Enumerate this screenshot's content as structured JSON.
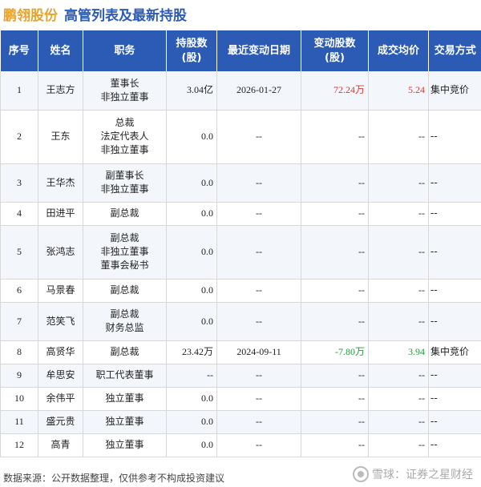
{
  "header": {
    "company": "鹏翎股份",
    "subtitle": "高管列表及最新持股"
  },
  "columns": [
    "序号",
    "姓名",
    "职务",
    "持股数\n(股)",
    "最近变动日期",
    "变动股数\n(股)",
    "成交均价",
    "交易方式"
  ],
  "rows": [
    {
      "no": "1",
      "name": "王志方",
      "roles": [
        "董事长",
        "非独立董事"
      ],
      "shares": "3.04亿",
      "date": "2026-01-27",
      "change": "72.24万",
      "change_color": "red",
      "price": "5.24",
      "price_color": "red",
      "method": "集中竞价"
    },
    {
      "no": "2",
      "name": "王东",
      "roles": [
        "总裁",
        "法定代表人",
        "非独立董事"
      ],
      "shares": "0.0",
      "date": "--",
      "change": "--",
      "change_color": "",
      "price": "--",
      "price_color": "",
      "method": "--"
    },
    {
      "no": "3",
      "name": "王华杰",
      "roles": [
        "副董事长",
        "非独立董事"
      ],
      "shares": "0.0",
      "date": "--",
      "change": "--",
      "change_color": "",
      "price": "--",
      "price_color": "",
      "method": "--"
    },
    {
      "no": "4",
      "name": "田进平",
      "roles": [
        "副总裁"
      ],
      "shares": "0.0",
      "date": "--",
      "change": "--",
      "change_color": "",
      "price": "--",
      "price_color": "",
      "method": "--"
    },
    {
      "no": "5",
      "name": "张鸿志",
      "roles": [
        "副总裁",
        "非独立董事",
        "董事会秘书"
      ],
      "shares": "0.0",
      "date": "--",
      "change": "--",
      "change_color": "",
      "price": "--",
      "price_color": "",
      "method": "--"
    },
    {
      "no": "6",
      "name": "马景春",
      "roles": [
        "副总裁"
      ],
      "shares": "0.0",
      "date": "--",
      "change": "--",
      "change_color": "",
      "price": "--",
      "price_color": "",
      "method": "--"
    },
    {
      "no": "7",
      "name": "范笑飞",
      "roles": [
        "副总裁",
        "财务总监"
      ],
      "shares": "0.0",
      "date": "--",
      "change": "--",
      "change_color": "",
      "price": "--",
      "price_color": "",
      "method": "--"
    },
    {
      "no": "8",
      "name": "高贤华",
      "roles": [
        "副总裁"
      ],
      "shares": "23.42万",
      "date": "2024-09-11",
      "change": "-7.80万",
      "change_color": "green",
      "price": "3.94",
      "price_color": "green",
      "method": "集中竞价"
    },
    {
      "no": "9",
      "name": "牟思安",
      "roles": [
        "职工代表董事"
      ],
      "shares": "--",
      "date": "--",
      "change": "--",
      "change_color": "",
      "price": "--",
      "price_color": "",
      "method": "--"
    },
    {
      "no": "10",
      "name": "余伟平",
      "roles": [
        "独立董事"
      ],
      "shares": "0.0",
      "date": "--",
      "change": "--",
      "change_color": "",
      "price": "--",
      "price_color": "",
      "method": "--"
    },
    {
      "no": "11",
      "name": "盛元贵",
      "roles": [
        "独立董事"
      ],
      "shares": "0.0",
      "date": "--",
      "change": "--",
      "change_color": "",
      "price": "--",
      "price_color": "",
      "method": "--"
    },
    {
      "no": "12",
      "name": "高青",
      "roles": [
        "独立董事"
      ],
      "shares": "0.0",
      "date": "--",
      "change": "--",
      "change_color": "",
      "price": "--",
      "price_color": "",
      "method": "--"
    }
  ],
  "footer": {
    "source": "数据来源：公开数据整理，仅供参考不构成投资建议"
  },
  "brand": {
    "text": "雪球：证券之星财经"
  },
  "watermark": {
    "text": "证券之星"
  },
  "colors": {
    "header_bg": "#2b5bb5",
    "company": "#e8a22e",
    "up": "#e0342c",
    "down": "#1f9d3a"
  }
}
